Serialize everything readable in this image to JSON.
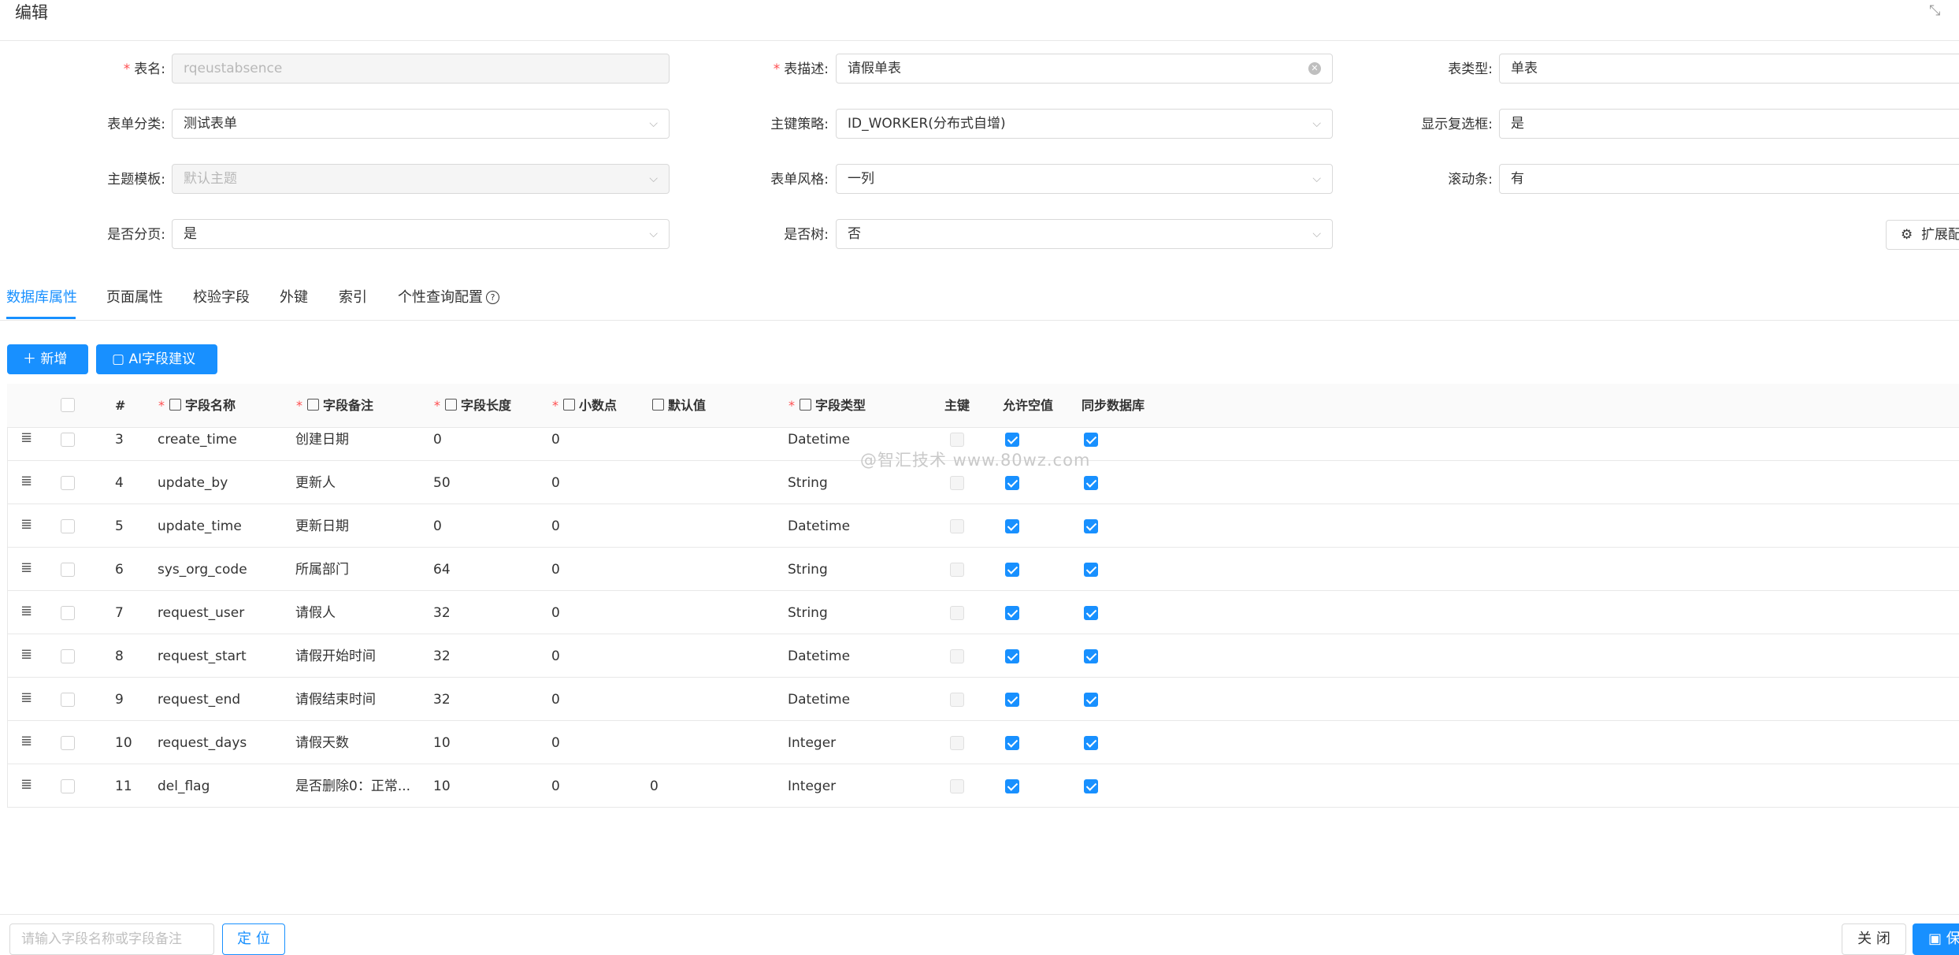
{
  "window": {
    "title": "编辑",
    "fullscreen_icon": "fullscreen-exit-icon"
  },
  "form": {
    "table_name": {
      "label": "表名",
      "required": true,
      "value": "rqeustabsence"
    },
    "table_desc": {
      "label": "表描述",
      "required": true,
      "value": "请假单表"
    },
    "table_type": {
      "label": "表类型",
      "value": "单表"
    },
    "form_category": {
      "label": "表单分类",
      "value": "测试表单"
    },
    "pk_strategy": {
      "label": "主键策略",
      "value": "ID_WORKER(分布式自增)"
    },
    "show_checkbox": {
      "label": "显示复选框",
      "value": "是"
    },
    "theme_template": {
      "label": "主题模板",
      "value": "默认主题"
    },
    "form_style": {
      "label": "表单风格",
      "value": "一列"
    },
    "scrollbar": {
      "label": "滚动条",
      "value": "有"
    },
    "paging": {
      "label": "是否分页",
      "value": "是"
    },
    "is_tree": {
      "label": "是否树",
      "value": "否"
    },
    "ext_button": "扩展配"
  },
  "tabs": [
    "数据库属性",
    "页面属性",
    "校验字段",
    "外键",
    "索引",
    "个性查询配置"
  ],
  "toolbar": {
    "add_label": "新增",
    "ai_label": "AI字段建议"
  },
  "table": {
    "columns": {
      "index": "#",
      "field_name": "字段名称",
      "field_comment": "字段备注",
      "field_length": "字段长度",
      "decimal": "小数点",
      "default_value": "默认值",
      "field_type": "字段类型",
      "primary_key": "主键",
      "nullable": "允许空值",
      "sync_db": "同步数据库"
    },
    "rows": [
      {
        "index": "3",
        "name": "create_time",
        "comment": "创建日期",
        "length": "0",
        "decimal": "0",
        "default": "",
        "type": "Datetime",
        "pk": false,
        "nullable": true,
        "sync": true
      },
      {
        "index": "4",
        "name": "update_by",
        "comment": "更新人",
        "length": "50",
        "decimal": "0",
        "default": "",
        "type": "String",
        "pk": false,
        "nullable": true,
        "sync": true
      },
      {
        "index": "5",
        "name": "update_time",
        "comment": "更新日期",
        "length": "0",
        "decimal": "0",
        "default": "",
        "type": "Datetime",
        "pk": false,
        "nullable": true,
        "sync": true
      },
      {
        "index": "6",
        "name": "sys_org_code",
        "comment": "所属部门",
        "length": "64",
        "decimal": "0",
        "default": "",
        "type": "String",
        "pk": false,
        "nullable": true,
        "sync": true
      },
      {
        "index": "7",
        "name": "request_user",
        "comment": "请假人",
        "length": "32",
        "decimal": "0",
        "default": "",
        "type": "String",
        "pk": false,
        "nullable": true,
        "sync": true
      },
      {
        "index": "8",
        "name": "request_start",
        "comment": "请假开始时间",
        "length": "32",
        "decimal": "0",
        "default": "",
        "type": "Datetime",
        "pk": false,
        "nullable": true,
        "sync": true
      },
      {
        "index": "9",
        "name": "request_end",
        "comment": "请假结束时间",
        "length": "32",
        "decimal": "0",
        "default": "",
        "type": "Datetime",
        "pk": false,
        "nullable": true,
        "sync": true
      },
      {
        "index": "10",
        "name": "request_days",
        "comment": "请假天数",
        "length": "10",
        "decimal": "0",
        "default": "",
        "type": "Integer",
        "pk": false,
        "nullable": true,
        "sync": true
      },
      {
        "index": "11",
        "name": "del_flag",
        "comment": "是否删除0：正常...",
        "length": "10",
        "decimal": "0",
        "default": "0",
        "type": "Integer",
        "pk": false,
        "nullable": true,
        "sync": true
      }
    ]
  },
  "watermark": "@智汇技术 www.80wz.com",
  "footer": {
    "search_placeholder": "请输入字段名称或字段备注",
    "locate_label": "定 位",
    "close_label": "关 闭",
    "save_label": "保存"
  },
  "colors": {
    "primary": "#1890ff",
    "required": "#ff4d4f",
    "border": "#d9d9d9"
  }
}
